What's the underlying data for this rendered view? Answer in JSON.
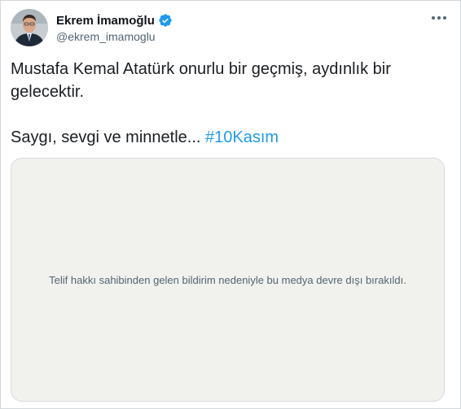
{
  "tweet": {
    "display_name": "Ekrem İmamoğlu",
    "handle": "@ekrem_imamoglu",
    "verified": true,
    "text_line1": "Mustafa Kemal Atatürk onurlu bir geçmiş, aydınlık bir gelecektir.",
    "text_line2_prefix": "Saygı, sevgi ve minnetle... ",
    "hashtag": "#10Kasım",
    "media_notice": "Telif hakkı sahibinden gelen bildirim nedeniyle bu medya devre dışı bırakıldı."
  },
  "icons": {
    "verified": "verified-badge-icon",
    "more": "more-options-icon"
  },
  "colors": {
    "accent": "#1d9bf0",
    "secondary_text": "#536471",
    "media_background": "#f1f2ee"
  }
}
